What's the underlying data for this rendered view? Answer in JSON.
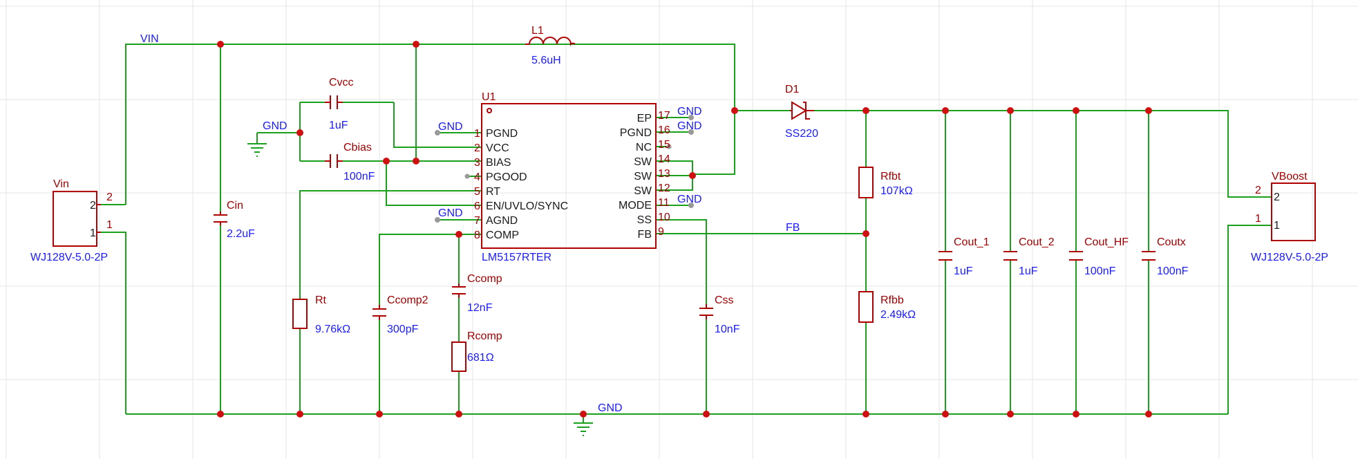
{
  "colors": {
    "background": "#ffffff",
    "grid": "#e6e6e6",
    "wire": "#1aa01a",
    "component": "#b00000",
    "junction": "#d01010",
    "net_label": "#1a1aff",
    "designator": "#a00000",
    "pin_text": "#1a1a1a"
  },
  "nets": {
    "vin": "VIN",
    "gnd": "GND",
    "fb": "FB"
  },
  "connectors": {
    "vin": {
      "ref": "Vin",
      "part": "WJ128V-5.0-2P",
      "pins": [
        "1",
        "2"
      ],
      "pin_numbers": [
        "1",
        "2"
      ]
    },
    "vboost": {
      "ref": "VBoost",
      "part": "WJ128V-5.0-2P",
      "pins": [
        "1",
        "2"
      ],
      "pin_numbers": [
        "1",
        "2"
      ]
    }
  },
  "ic": {
    "ref": "U1",
    "part": "LM5157RTER",
    "left_pins": [
      {
        "num": "1",
        "name": "PGND"
      },
      {
        "num": "2",
        "name": "VCC"
      },
      {
        "num": "3",
        "name": "BIAS"
      },
      {
        "num": "4",
        "name": "PGOOD"
      },
      {
        "num": "5",
        "name": "RT"
      },
      {
        "num": "6",
        "name": "EN/UVLO/SYNC"
      },
      {
        "num": "7",
        "name": "AGND"
      },
      {
        "num": "8",
        "name": "COMP"
      }
    ],
    "right_pins": [
      {
        "num": "17",
        "name": "EP"
      },
      {
        "num": "16",
        "name": "PGND"
      },
      {
        "num": "15",
        "name": "NC"
      },
      {
        "num": "14",
        "name": "SW"
      },
      {
        "num": "13",
        "name": "SW"
      },
      {
        "num": "12",
        "name": "SW"
      },
      {
        "num": "11",
        "name": "MODE"
      },
      {
        "num": "10",
        "name": "SS"
      },
      {
        "num": "9",
        "name": "FB"
      }
    ]
  },
  "components": {
    "l1": {
      "ref": "L1",
      "value": "5.6uH"
    },
    "d1": {
      "ref": "D1",
      "value": "SS220"
    },
    "cvcc": {
      "ref": "Cvcc",
      "value": "1uF"
    },
    "cbias": {
      "ref": "Cbias",
      "value": "100nF"
    },
    "cin": {
      "ref": "Cin",
      "value": "2.2uF"
    },
    "rt": {
      "ref": "Rt",
      "value": "9.76kΩ"
    },
    "ccomp2": {
      "ref": "Ccomp2",
      "value": "300pF"
    },
    "ccomp": {
      "ref": "Ccomp",
      "value": "12nF"
    },
    "rcomp": {
      "ref": "Rcomp",
      "value": "681Ω"
    },
    "css": {
      "ref": "Css",
      "value": "10nF"
    },
    "rfbt": {
      "ref": "Rfbt",
      "value": "107kΩ"
    },
    "rfbb": {
      "ref": "Rfbb",
      "value": "2.49kΩ"
    },
    "cout1": {
      "ref": "Cout_1",
      "value": "1uF"
    },
    "cout2": {
      "ref": "Cout_2",
      "value": "1uF"
    },
    "couthf": {
      "ref": "Cout_HF",
      "value": "100nF"
    },
    "coutx": {
      "ref": "Coutx",
      "value": "100nF"
    }
  }
}
